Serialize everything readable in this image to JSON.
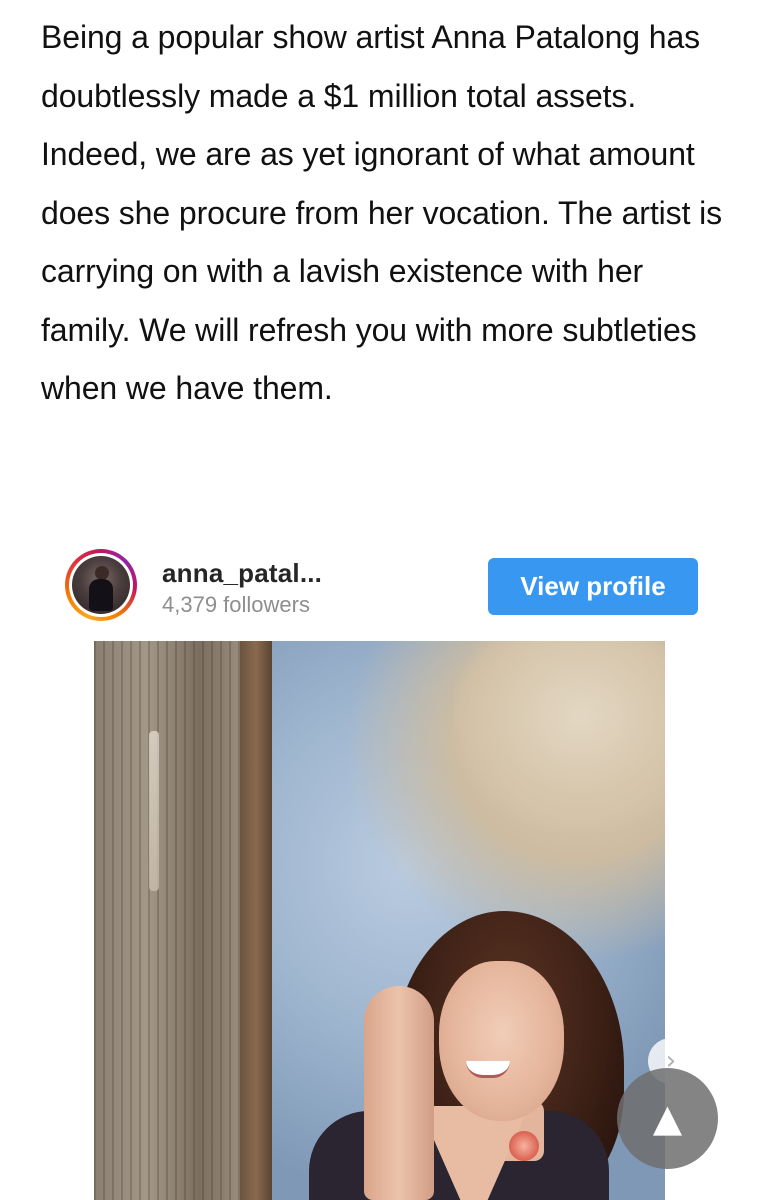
{
  "article": {
    "paragraph": "Being a popular show artist Anna Patalong has doubtlessly made a $1 million total assets. Indeed, we are as yet ignorant of what amount does she procure from her vocation. The artist is carrying on with a lavish existence with her family. We will refresh you with more subtleties when we have them."
  },
  "instagram_embed": {
    "username": "anna_patal...",
    "followers": "4,379 followers",
    "view_profile_label": "View profile",
    "button_color": "#3897f0"
  },
  "controls": {
    "carousel_next_icon": "›",
    "scroll_top_icon": "▲"
  }
}
